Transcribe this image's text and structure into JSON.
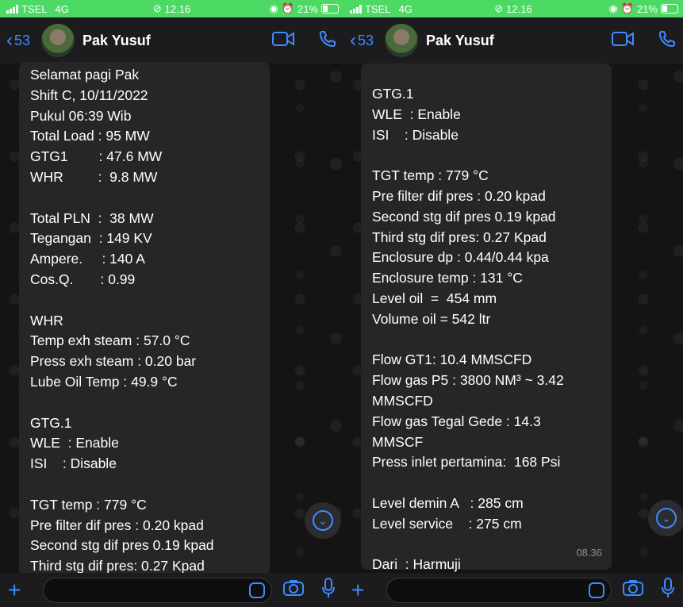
{
  "status": {
    "carrier": "TSEL",
    "network": "4G",
    "time": "12.16",
    "battery": "21%"
  },
  "header": {
    "back_count": "53",
    "contact_name": "Pak Yusuf"
  },
  "left_message": {
    "lines": [
      "Selamat pagi Pak",
      "Shift C, 10/11/2022",
      "Pukul 06:39 Wib",
      "Total Load : 95 MW",
      "GTG1        : 47.6 MW",
      "WHR         :  9.8 MW",
      "",
      "Total PLN  :  38 MW",
      "Tegangan  : 149 KV",
      "Ampere.     : 140 A",
      "Cos.Q.       : 0.99",
      "",
      "WHR",
      "Temp exh steam : 57.0 °C",
      "Press exh steam : 0.20 bar",
      "Lube Oil Temp : 49.9 °C",
      "",
      "GTG.1",
      "WLE  : Enable",
      "ISI    : Disable",
      "",
      "TGT temp : 779 °C",
      "Pre filter dif pres : 0.20 kpad",
      "Second stg dif pres 0.19 kpad",
      "Third stg dif pres: 0.27 Kpad",
      "Enclosure dp : 0.44/0.44 kpa"
    ]
  },
  "right_message": {
    "lines": [
      "GTG.1",
      "WLE  : Enable",
      "ISI    : Disable",
      "",
      "TGT temp : 779 °C",
      "Pre filter dif pres : 0.20 kpad",
      "Second stg dif pres 0.19 kpad",
      "Third stg dif pres: 0.27 Kpad",
      "Enclosure dp : 0.44/0.44 kpa",
      "Enclosure temp : 131 °C",
      "Level oil  =  454 mm",
      "Volume oil = 542 ltr",
      "",
      "Flow GT1: 10.4 MMSCFD",
      "Flow gas P5 : 3800 NM³ ~ 3.42",
      "MMSCFD",
      "Flow gas Tegal Gede : 14.3",
      "MMSCF",
      "Press inlet pertamina:  168 Psi",
      "",
      "Level demin A   : 285 cm",
      "Level service    : 275 cm",
      "",
      "Dari  : Harmuji"
    ],
    "time": "08.36"
  },
  "icons": {
    "video": "video-camera-icon",
    "phone": "phone-icon",
    "camera": "camera-icon",
    "mic": "microphone-icon",
    "plus": "plus-icon",
    "sticker": "sticker-icon",
    "scroll": "chevron-down-icon"
  },
  "colors": {
    "accent": "#3d8bff",
    "statusbar": "#4cd964",
    "bubble": "#262628"
  }
}
